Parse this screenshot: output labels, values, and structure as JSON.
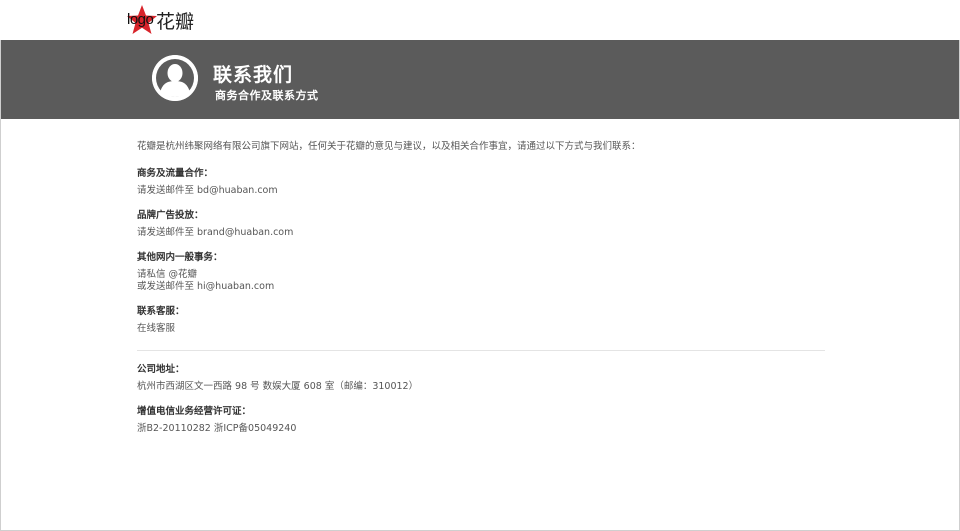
{
  "header": {
    "logo_text": "logo",
    "brand": "花瓣",
    "logo_color": "#d8232a"
  },
  "banner": {
    "title": "联系我们",
    "subtitle": "商务合作及联系方式",
    "background": "#5b5b5b"
  },
  "content": {
    "intro": "花瓣是杭州纬聚网络有限公司旗下网站，任何关于花瓣的意见与建议，以及相关合作事宜，请通过以下方式与我们联系：",
    "sections": [
      {
        "title": "商务及流量合作：",
        "lines": [
          "请发送邮件至 bd@huaban.com"
        ]
      },
      {
        "title": "品牌广告投放：",
        "lines": [
          "请发送邮件至 brand@huaban.com"
        ]
      },
      {
        "title": "其他网内一般事务：",
        "lines": [
          "请私信 @花瓣",
          "或发送邮件至 hi@huaban.com"
        ]
      },
      {
        "title": "联系客服：",
        "lines": [
          "在线客服"
        ]
      }
    ],
    "company": [
      {
        "title": "公司地址：",
        "lines": [
          "杭州市西湖区文一西路 98 号 数娱大厦 608 室（邮编：310012）"
        ]
      },
      {
        "title": "增值电信业务经营许可证：",
        "lines": [
          "浙B2-20110282 浙ICP备05049240"
        ]
      }
    ]
  }
}
